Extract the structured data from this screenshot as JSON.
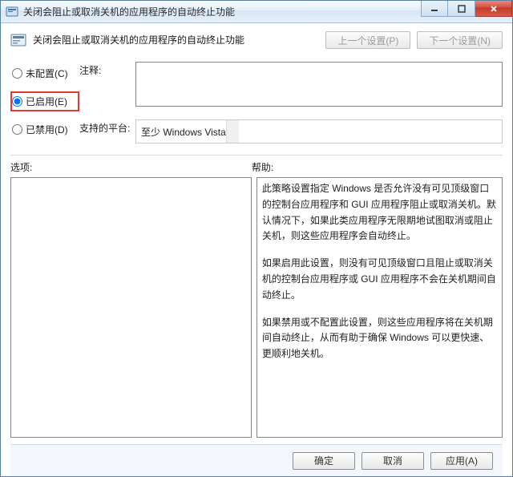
{
  "titlebar": {
    "title": "关闭会阻止或取消关机的应用程序的自动终止功能"
  },
  "header": {
    "policy_title": "关闭会阻止或取消关机的应用程序的自动终止功能",
    "prev_btn": "上一个设置(P)",
    "next_btn": "下一个设置(N)"
  },
  "config": {
    "not_configured": "未配置(C)",
    "enabled": "已启用(E)",
    "disabled": "已禁用(D)",
    "selected": "enabled"
  },
  "fields": {
    "comment_label": "注释:",
    "comment_value": "",
    "platform_label": "支持的平台:",
    "platform_value": "至少 Windows Vista"
  },
  "labels": {
    "options": "选项:",
    "help": "帮助:"
  },
  "help": {
    "p1": "此策略设置指定 Windows 是否允许没有可见顶级窗口的控制台应用程序和 GUI 应用程序阻止或取消关机。默认情况下，如果此类应用程序无限期地试图取消或阻止关机，则这些应用程序会自动终止。",
    "p2": "如果启用此设置，则没有可见顶级窗口且阻止或取消关机的控制台应用程序或 GUI 应用程序不会在关机期间自动终止。",
    "p3": "如果禁用或不配置此设置，则这些应用程序将在关机期间自动终止，从而有助于确保 Windows 可以更快速、更顺利地关机。"
  },
  "footer": {
    "ok": "确定",
    "cancel": "取消",
    "apply": "应用(A)"
  }
}
